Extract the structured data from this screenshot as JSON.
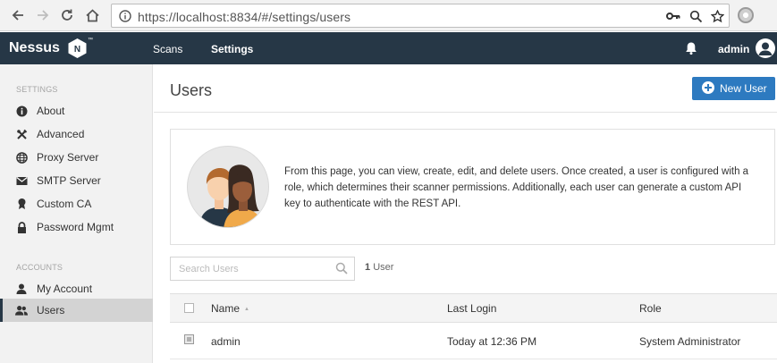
{
  "browser": {
    "url": "https://localhost:8834/#/settings/users"
  },
  "header": {
    "logo": "Nessus",
    "logo_badge": "N",
    "nav": [
      {
        "label": "Scans"
      },
      {
        "label": "Settings"
      }
    ],
    "user": "admin"
  },
  "sidebar": {
    "settings_heading": "SETTINGS",
    "settings_items": [
      {
        "label": "About",
        "icon": "info-icon"
      },
      {
        "label": "Advanced",
        "icon": "tools-icon"
      },
      {
        "label": "Proxy Server",
        "icon": "globe-icon"
      },
      {
        "label": "SMTP Server",
        "icon": "envelope-icon"
      },
      {
        "label": "Custom CA",
        "icon": "certificate-icon"
      },
      {
        "label": "Password Mgmt",
        "icon": "lock-icon"
      }
    ],
    "accounts_heading": "ACCOUNTS",
    "account_items": [
      {
        "label": "My Account",
        "icon": "user-icon"
      },
      {
        "label": "Users",
        "icon": "users-icon"
      }
    ]
  },
  "main": {
    "title": "Users",
    "new_button": "New User",
    "info_text": "From this page, you can view, create, edit, and delete users. Once created, a user is configured with a role, which determines their scanner permissions. Additionally, each user can generate a custom API key to authenticate with the REST API.",
    "search_placeholder": "Search Users",
    "count_number": "1",
    "count_label": "User",
    "columns": [
      "Name",
      "Last Login",
      "Role"
    ],
    "rows": [
      {
        "name": "admin",
        "last_login": "Today at 12:36 PM",
        "role": "System Administrator"
      }
    ]
  },
  "colors": {
    "header_bg": "#263746",
    "primary_button": "#2d7ac0"
  }
}
